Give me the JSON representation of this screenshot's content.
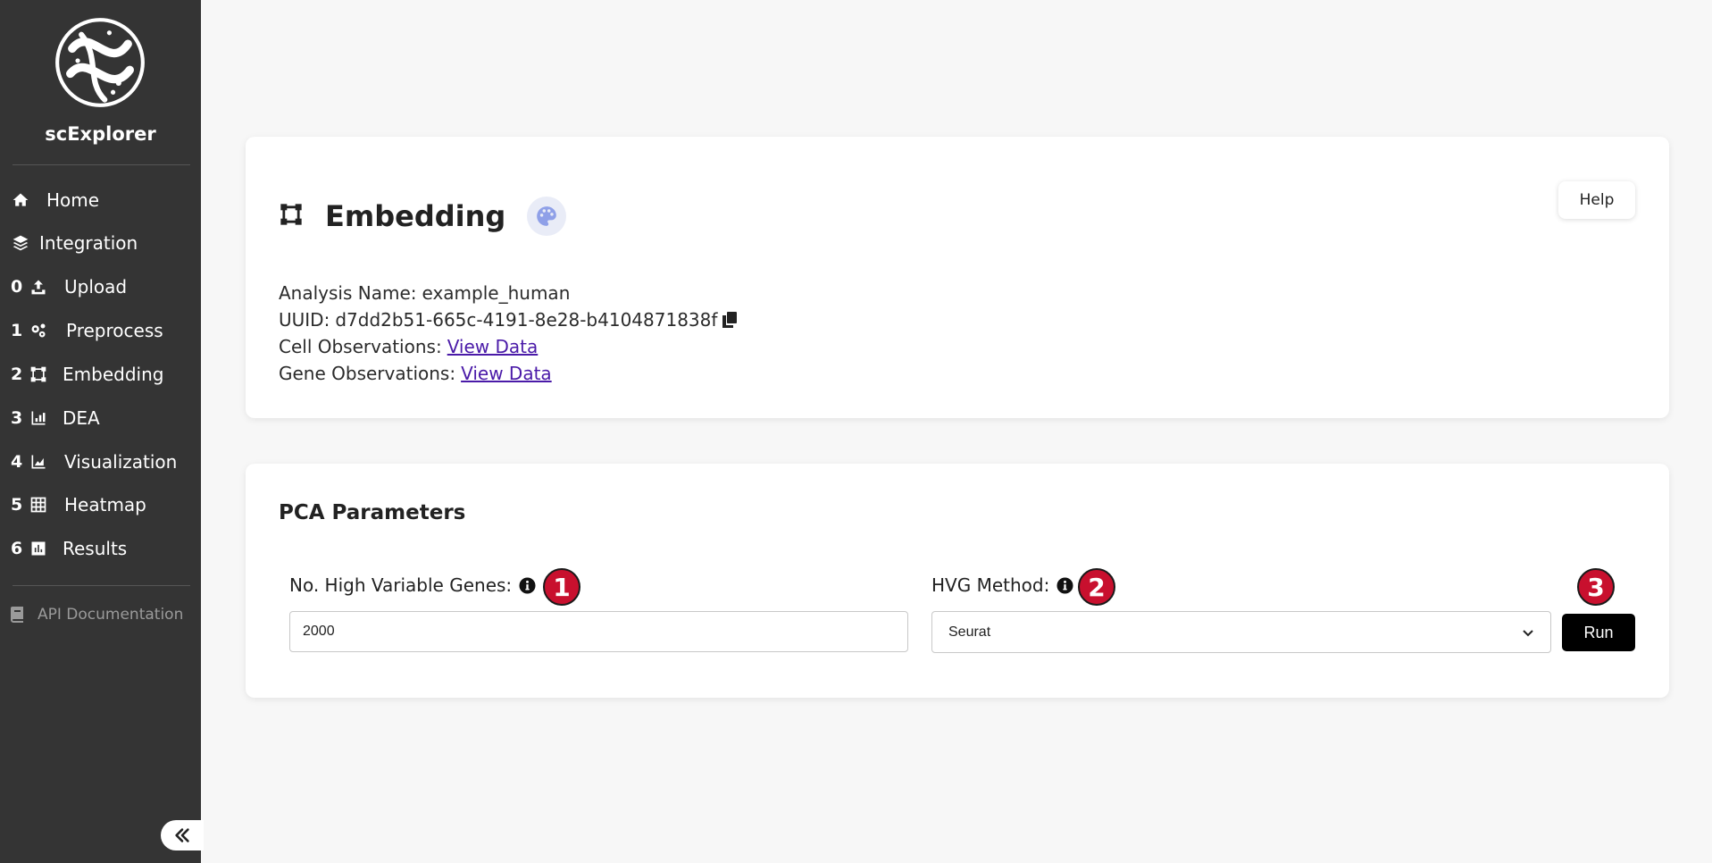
{
  "sidebar": {
    "app_name": "scExplorer",
    "items": [
      {
        "num": "",
        "label": "Home",
        "icon": "home-icon"
      },
      {
        "num": "",
        "label": "Integration",
        "icon": "layers-icon"
      },
      {
        "num": "0",
        "label": "Upload",
        "icon": "upload-icon"
      },
      {
        "num": "1",
        "label": "Preprocess",
        "icon": "gears-icon"
      },
      {
        "num": "2",
        "label": "Embedding",
        "icon": "vector-square-icon"
      },
      {
        "num": "3",
        "label": "DEA",
        "icon": "bar-chart-icon"
      },
      {
        "num": "4",
        "label": "Visualization",
        "icon": "area-chart-icon"
      },
      {
        "num": "5",
        "label": "Heatmap",
        "icon": "grid-icon"
      },
      {
        "num": "6",
        "label": "Results",
        "icon": "poll-icon"
      }
    ],
    "api_doc_label": "API Documentation",
    "collapse_icon": "double-chevron-left-icon"
  },
  "info_card": {
    "title": "Embedding",
    "help_label": "Help",
    "analysis_name_label": "Analysis Name:",
    "analysis_name": "example_human",
    "uuid_label": "UUID:",
    "uuid": "d7dd2b51-665c-4191-8e28-b4104871838f",
    "cell_obs_label": "Cell Observations:",
    "cell_obs_link": "View Data",
    "gene_obs_label": "Gene Observations:",
    "gene_obs_link": "View Data"
  },
  "params_card": {
    "title": "PCA Parameters",
    "hvg_genes_label": "No. High Variable Genes:",
    "hvg_genes_value": "2000",
    "hvg_method_label": "HVG Method:",
    "hvg_method_value": "Seurat",
    "run_label": "Run",
    "badges": [
      "1",
      "2",
      "3"
    ]
  },
  "colors": {
    "sidebar_bg": "#343434",
    "badge_red": "#c8102e",
    "link": "#4a1aa8",
    "run_button": "#000000"
  }
}
